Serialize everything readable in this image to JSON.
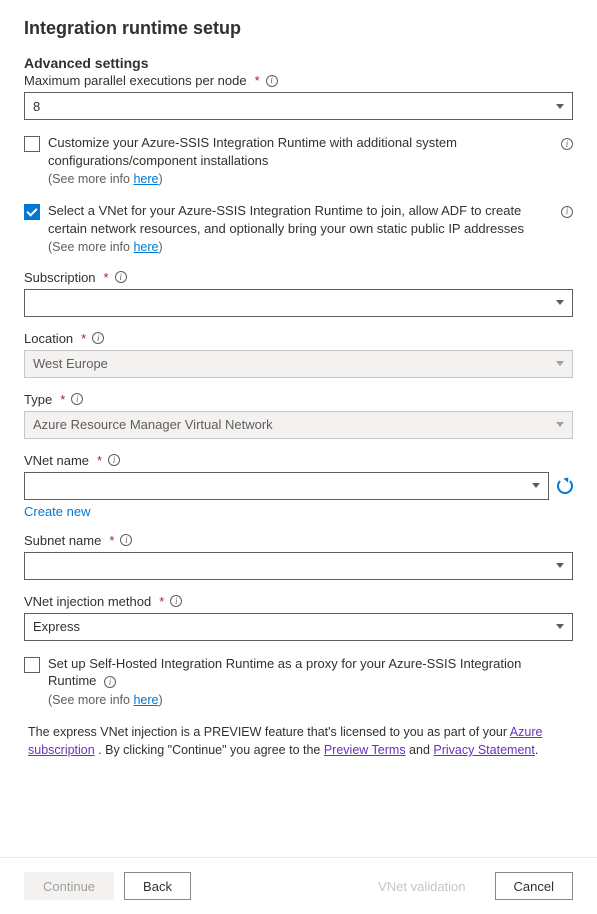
{
  "title": "Integration runtime setup",
  "section_title": "Advanced settings",
  "max_parallel": {
    "label": "Maximum parallel executions per node",
    "value": "8"
  },
  "customize": {
    "text": "Customize your Azure-SSIS Integration Runtime with additional system configurations/component installations",
    "see_more_prefix": "(See more info ",
    "see_more_link": "here",
    "see_more_suffix": ")"
  },
  "vnet_option": {
    "text": "Select a VNet for your Azure-SSIS Integration Runtime to join, allow ADF to create certain network resources, and optionally bring your own static public IP addresses",
    "see_more_prefix": "(See more info ",
    "see_more_link": "here",
    "see_more_suffix": ")"
  },
  "subscription": {
    "label": "Subscription",
    "value": ""
  },
  "location": {
    "label": "Location",
    "value": "West Europe"
  },
  "type": {
    "label": "Type",
    "value": "Azure Resource Manager Virtual Network"
  },
  "vnet_name": {
    "label": "VNet name",
    "value": "",
    "create_new": "Create new"
  },
  "subnet_name": {
    "label": "Subnet name",
    "value": ""
  },
  "injection": {
    "label": "VNet injection method",
    "value": "Express"
  },
  "shir": {
    "text": "Set up Self-Hosted Integration Runtime as a proxy for your Azure-SSIS Integration Runtime",
    "see_more_prefix": "(See more info ",
    "see_more_link": "here",
    "see_more_suffix": ")"
  },
  "preview": {
    "p1a": "The express VNet injection is a PREVIEW feature that's licensed to you as part of your ",
    "azure_sub": "Azure subscription",
    "p1b": " . By clicking \"Continue\" you agree to the ",
    "preview_terms": "Preview Terms",
    "and": " and ",
    "privacy": "Privacy Statement",
    "end": "."
  },
  "footer": {
    "continue": "Continue",
    "back": "Back",
    "vnet_validation": "VNet validation",
    "cancel": "Cancel"
  }
}
